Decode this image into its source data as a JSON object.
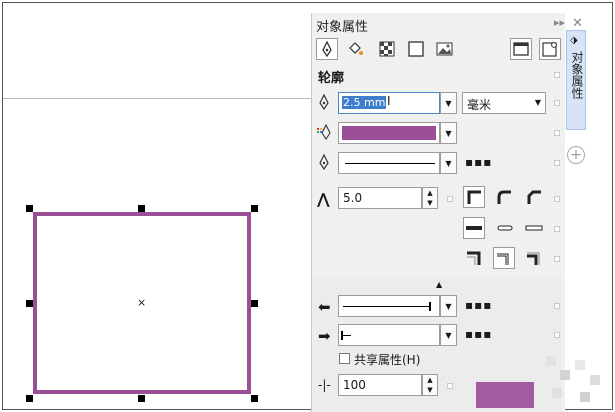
{
  "panel": {
    "title": "对象属性",
    "tab_vertical": "对象属性",
    "section": "轮廓",
    "width_value": "2.5 mm",
    "unit": "毫米",
    "miter_value": "5.0",
    "share_label": "共享属性(H)",
    "scale_value": "100",
    "more": "▪▪▪",
    "arrow_up": "▲"
  },
  "colors": {
    "outline": "#9b4f96",
    "accent": "#4a86c8"
  }
}
